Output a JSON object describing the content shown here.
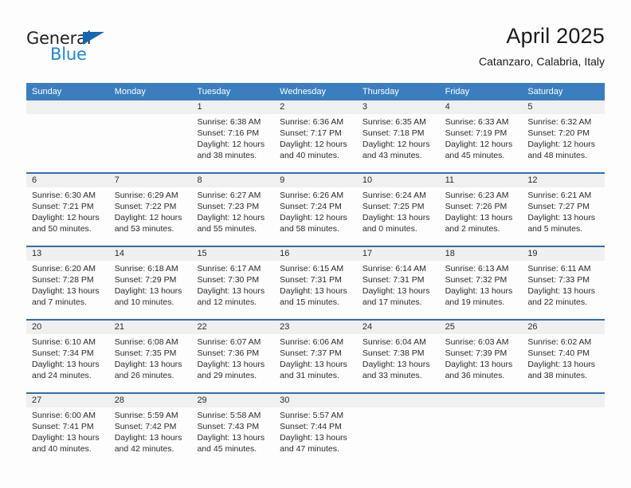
{
  "brand": {
    "name_part1": "General",
    "name_part2": "Blue",
    "logo_icon": "triangle-icon",
    "accent_color": "#1268b3",
    "accent_color_light": "#1e88d2"
  },
  "header": {
    "title": "April 2025",
    "subtitle": "Catanzaro, Calabria, Italy"
  },
  "theme": {
    "header_blue": "#3a7ebf",
    "separator_blue": "#2f6fae",
    "daynum_band": "#f0f0f0",
    "text": "#2b2b2b"
  },
  "weekdays": [
    "Sunday",
    "Monday",
    "Tuesday",
    "Wednesday",
    "Thursday",
    "Friday",
    "Saturday"
  ],
  "weeks": [
    {
      "days": [
        {
          "num": "",
          "lines": [
            "",
            "",
            "",
            ""
          ]
        },
        {
          "num": "",
          "lines": [
            "",
            "",
            "",
            ""
          ]
        },
        {
          "num": "1",
          "lines": [
            "Sunrise: 6:38 AM",
            "Sunset: 7:16 PM",
            "Daylight: 12 hours",
            "and 38 minutes."
          ]
        },
        {
          "num": "2",
          "lines": [
            "Sunrise: 6:36 AM",
            "Sunset: 7:17 PM",
            "Daylight: 12 hours",
            "and 40 minutes."
          ]
        },
        {
          "num": "3",
          "lines": [
            "Sunrise: 6:35 AM",
            "Sunset: 7:18 PM",
            "Daylight: 12 hours",
            "and 43 minutes."
          ]
        },
        {
          "num": "4",
          "lines": [
            "Sunrise: 6:33 AM",
            "Sunset: 7:19 PM",
            "Daylight: 12 hours",
            "and 45 minutes."
          ]
        },
        {
          "num": "5",
          "lines": [
            "Sunrise: 6:32 AM",
            "Sunset: 7:20 PM",
            "Daylight: 12 hours",
            "and 48 minutes."
          ]
        }
      ]
    },
    {
      "days": [
        {
          "num": "6",
          "lines": [
            "Sunrise: 6:30 AM",
            "Sunset: 7:21 PM",
            "Daylight: 12 hours",
            "and 50 minutes."
          ]
        },
        {
          "num": "7",
          "lines": [
            "Sunrise: 6:29 AM",
            "Sunset: 7:22 PM",
            "Daylight: 12 hours",
            "and 53 minutes."
          ]
        },
        {
          "num": "8",
          "lines": [
            "Sunrise: 6:27 AM",
            "Sunset: 7:23 PM",
            "Daylight: 12 hours",
            "and 55 minutes."
          ]
        },
        {
          "num": "9",
          "lines": [
            "Sunrise: 6:26 AM",
            "Sunset: 7:24 PM",
            "Daylight: 12 hours",
            "and 58 minutes."
          ]
        },
        {
          "num": "10",
          "lines": [
            "Sunrise: 6:24 AM",
            "Sunset: 7:25 PM",
            "Daylight: 13 hours",
            "and 0 minutes."
          ]
        },
        {
          "num": "11",
          "lines": [
            "Sunrise: 6:23 AM",
            "Sunset: 7:26 PM",
            "Daylight: 13 hours",
            "and 2 minutes."
          ]
        },
        {
          "num": "12",
          "lines": [
            "Sunrise: 6:21 AM",
            "Sunset: 7:27 PM",
            "Daylight: 13 hours",
            "and 5 minutes."
          ]
        }
      ]
    },
    {
      "days": [
        {
          "num": "13",
          "lines": [
            "Sunrise: 6:20 AM",
            "Sunset: 7:28 PM",
            "Daylight: 13 hours",
            "and 7 minutes."
          ]
        },
        {
          "num": "14",
          "lines": [
            "Sunrise: 6:18 AM",
            "Sunset: 7:29 PM",
            "Daylight: 13 hours",
            "and 10 minutes."
          ]
        },
        {
          "num": "15",
          "lines": [
            "Sunrise: 6:17 AM",
            "Sunset: 7:30 PM",
            "Daylight: 13 hours",
            "and 12 minutes."
          ]
        },
        {
          "num": "16",
          "lines": [
            "Sunrise: 6:15 AM",
            "Sunset: 7:31 PM",
            "Daylight: 13 hours",
            "and 15 minutes."
          ]
        },
        {
          "num": "17",
          "lines": [
            "Sunrise: 6:14 AM",
            "Sunset: 7:31 PM",
            "Daylight: 13 hours",
            "and 17 minutes."
          ]
        },
        {
          "num": "18",
          "lines": [
            "Sunrise: 6:13 AM",
            "Sunset: 7:32 PM",
            "Daylight: 13 hours",
            "and 19 minutes."
          ]
        },
        {
          "num": "19",
          "lines": [
            "Sunrise: 6:11 AM",
            "Sunset: 7:33 PM",
            "Daylight: 13 hours",
            "and 22 minutes."
          ]
        }
      ]
    },
    {
      "days": [
        {
          "num": "20",
          "lines": [
            "Sunrise: 6:10 AM",
            "Sunset: 7:34 PM",
            "Daylight: 13 hours",
            "and 24 minutes."
          ]
        },
        {
          "num": "21",
          "lines": [
            "Sunrise: 6:08 AM",
            "Sunset: 7:35 PM",
            "Daylight: 13 hours",
            "and 26 minutes."
          ]
        },
        {
          "num": "22",
          "lines": [
            "Sunrise: 6:07 AM",
            "Sunset: 7:36 PM",
            "Daylight: 13 hours",
            "and 29 minutes."
          ]
        },
        {
          "num": "23",
          "lines": [
            "Sunrise: 6:06 AM",
            "Sunset: 7:37 PM",
            "Daylight: 13 hours",
            "and 31 minutes."
          ]
        },
        {
          "num": "24",
          "lines": [
            "Sunrise: 6:04 AM",
            "Sunset: 7:38 PM",
            "Daylight: 13 hours",
            "and 33 minutes."
          ]
        },
        {
          "num": "25",
          "lines": [
            "Sunrise: 6:03 AM",
            "Sunset: 7:39 PM",
            "Daylight: 13 hours",
            "and 36 minutes."
          ]
        },
        {
          "num": "26",
          "lines": [
            "Sunrise: 6:02 AM",
            "Sunset: 7:40 PM",
            "Daylight: 13 hours",
            "and 38 minutes."
          ]
        }
      ]
    },
    {
      "days": [
        {
          "num": "27",
          "lines": [
            "Sunrise: 6:00 AM",
            "Sunset: 7:41 PM",
            "Daylight: 13 hours",
            "and 40 minutes."
          ]
        },
        {
          "num": "28",
          "lines": [
            "Sunrise: 5:59 AM",
            "Sunset: 7:42 PM",
            "Daylight: 13 hours",
            "and 42 minutes."
          ]
        },
        {
          "num": "29",
          "lines": [
            "Sunrise: 5:58 AM",
            "Sunset: 7:43 PM",
            "Daylight: 13 hours",
            "and 45 minutes."
          ]
        },
        {
          "num": "30",
          "lines": [
            "Sunrise: 5:57 AM",
            "Sunset: 7:44 PM",
            "Daylight: 13 hours",
            "and 47 minutes."
          ]
        },
        {
          "num": "",
          "lines": [
            "",
            "",
            "",
            ""
          ]
        },
        {
          "num": "",
          "lines": [
            "",
            "",
            "",
            ""
          ]
        },
        {
          "num": "",
          "lines": [
            "",
            "",
            "",
            ""
          ]
        }
      ]
    }
  ]
}
